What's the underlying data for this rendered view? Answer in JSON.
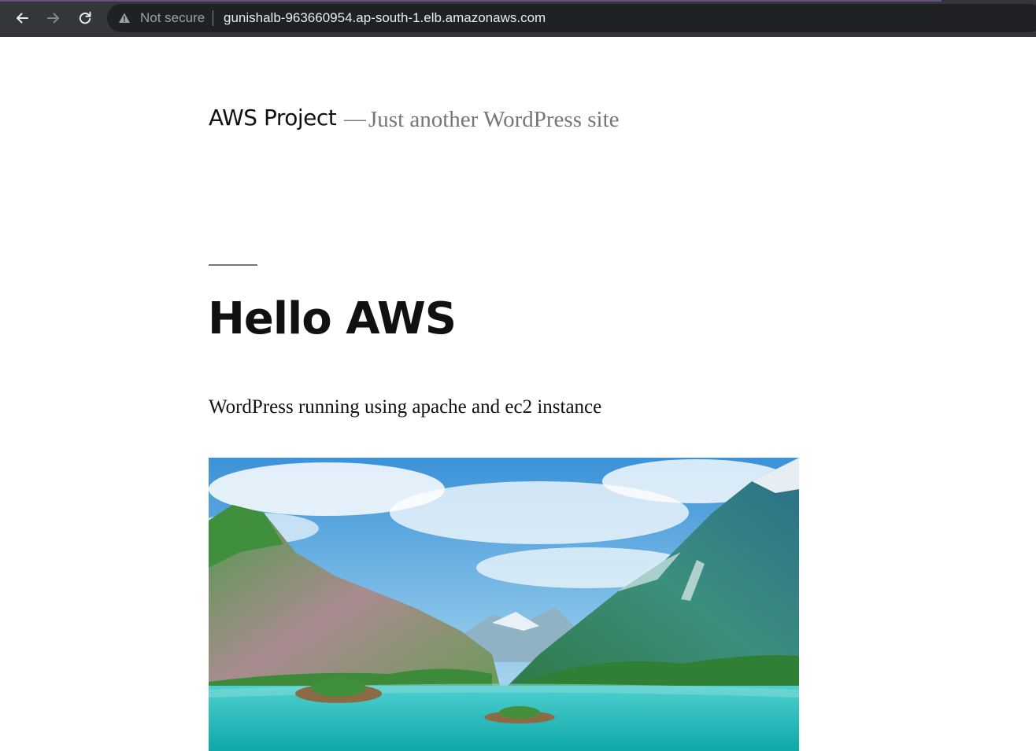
{
  "browser": {
    "security_label": "Not secure",
    "url": "gunishalb-963660954.ap-south-1.elb.amazonaws.com",
    "icons": [
      "back-icon",
      "forward-icon",
      "reload-icon",
      "warning-icon"
    ]
  },
  "site": {
    "title": "AWS Project",
    "separator": "—",
    "tagline": "Just another WordPress site"
  },
  "post": {
    "title": "Hello AWS",
    "body": "WordPress running using apache and ec2 instance"
  }
}
